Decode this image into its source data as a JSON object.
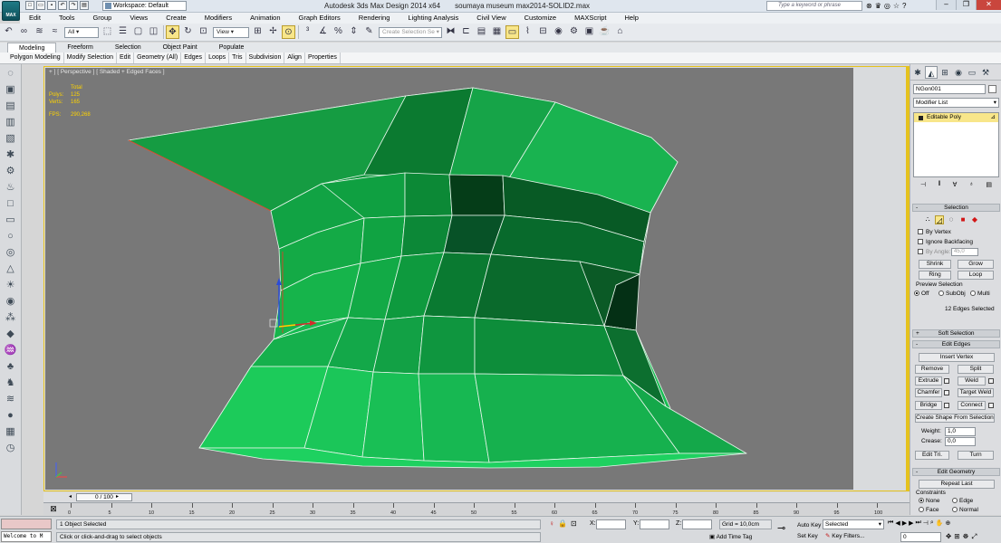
{
  "window": {
    "app_title": "Autodesk 3ds Max Design 2014 x64",
    "doc_title": "soumaya museum max2014-SOLID2.max",
    "workspace": "Workspace: Default",
    "search_placeholder": "Type a keyword or phrase",
    "logo_text": "MAX"
  },
  "menu": [
    "Edit",
    "Tools",
    "Group",
    "Views",
    "Create",
    "Modifiers",
    "Animation",
    "Graph Editors",
    "Rendering",
    "Lighting Analysis",
    "Civil View",
    "Customize",
    "MAXScript",
    "Help"
  ],
  "toolbar": {
    "filter": "All",
    "ref_coord": "View",
    "selection_set": "Create Selection Se"
  },
  "ribbon": {
    "tabs": [
      "Modeling",
      "Freeform",
      "Selection",
      "Object Paint",
      "Populate"
    ],
    "panels": [
      "Polygon Modeling",
      "Modify Selection",
      "Edit",
      "Geometry (All)",
      "Edges",
      "Loops",
      "Tris",
      "Subdivision",
      "Align",
      "Properties"
    ]
  },
  "viewport": {
    "label": "+ ] [ Perspective ] [ Shaded + Edged Faces ]",
    "stats_total": "Total",
    "polys_label": "Polys:",
    "polys_value": "125",
    "verts_label": "Verts:",
    "verts_value": "165",
    "fps_label": "FPS:",
    "fps_value": "290,268"
  },
  "command_panel": {
    "object_name": "NGon001",
    "modifier_list": "Modifier List",
    "stack_item": "Editable Poly",
    "selection": {
      "header": "Selection",
      "by_vertex": "By Vertex",
      "ignore_backfacing": "Ignore Backfacing",
      "by_angle": "By Angle:",
      "angle_value": "45,0",
      "shrink": "Shrink",
      "grow": "Grow",
      "ring": "Ring",
      "loop": "Loop",
      "preview_label": "Preview Selection",
      "preview_off": "Off",
      "preview_subobj": "SubObj",
      "preview_multi": "Multi",
      "status": "12 Edges Selected"
    },
    "soft_selection": "Soft Selection",
    "edit_edges": {
      "header": "Edit Edges",
      "insert_vertex": "Insert Vertex",
      "remove": "Remove",
      "split": "Split",
      "extrude": "Extrude",
      "weld": "Weld",
      "chamfer": "Chamfer",
      "target_weld": "Target Weld",
      "bridge": "Bridge",
      "connect": "Connect",
      "create_shape": "Create Shape From Selection",
      "weight_label": "Weight:",
      "weight_value": "1,0",
      "crease_label": "Crease:",
      "crease_value": "0,0",
      "edit_tri": "Edit Tri.",
      "turn": "Turn"
    },
    "edit_geometry": {
      "header": "Edit Geometry",
      "repeat_last": "Repeat Last",
      "constraints": "Constraints",
      "none": "None",
      "edge": "Edge",
      "face": "Face",
      "normal": "Normal"
    }
  },
  "timeline": {
    "slider": "0 / 100",
    "ticks": [
      "0",
      "5",
      "10",
      "15",
      "20",
      "25",
      "30",
      "35",
      "40",
      "45",
      "50",
      "55",
      "60",
      "65",
      "70",
      "75",
      "80",
      "85",
      "90",
      "95",
      "100"
    ]
  },
  "status": {
    "maxscript_listener": "Welcome to M",
    "objects_selected": "1 Object Selected",
    "prompt": "Click or click-and-drag to select objects",
    "x_label": "X:",
    "y_label": "Y:",
    "z_label": "Z:",
    "grid": "Grid = 10,0cm",
    "add_time_tag": "Add Time Tag",
    "auto_key": "Auto Key",
    "set_key": "Set Key",
    "key_mode": "Selected",
    "key_filters": "Key Filters...",
    "frame": "0"
  },
  "colors": {
    "viewport_bg": "#787878",
    "mesh_green": "#12a046",
    "mesh_light": "#19c45a",
    "mesh_dark": "#0a6a2c",
    "active_border": "#e5c21d",
    "stats_text": "#ffd400"
  }
}
